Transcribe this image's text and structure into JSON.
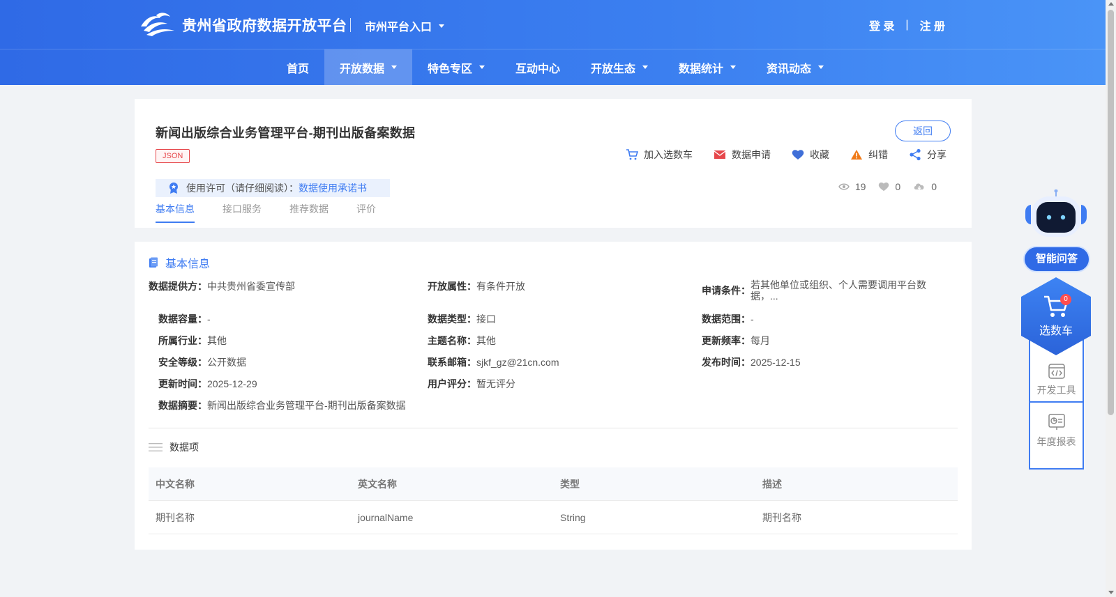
{
  "header": {
    "site_title": "贵州省政府数据开放平台",
    "city_entry": "市州平台入口",
    "login": "登 录",
    "auth_sep": "|",
    "register": "注 册"
  },
  "nav": {
    "items": [
      {
        "label": "首页",
        "has_dropdown": false,
        "active": false
      },
      {
        "label": "开放数据",
        "has_dropdown": true,
        "active": true
      },
      {
        "label": "特色专区",
        "has_dropdown": true,
        "active": false
      },
      {
        "label": "互动中心",
        "has_dropdown": false,
        "active": false
      },
      {
        "label": "开放生态",
        "has_dropdown": true,
        "active": false
      },
      {
        "label": "数据统计",
        "has_dropdown": true,
        "active": false
      },
      {
        "label": "资讯动态",
        "has_dropdown": true,
        "active": false
      }
    ]
  },
  "dataset": {
    "title": "新闻出版综合业务管理平台-期刊出版备案数据",
    "format_tag": "JSON",
    "back_label": "返回",
    "actions": {
      "add_cart": "加入选数车",
      "apply": "数据申请",
      "favorite": "收藏",
      "report_error": "纠错",
      "share": "分享"
    },
    "license_label": "使用许可（请仔细阅读）：",
    "license_link": "数据使用承诺书",
    "stats": {
      "views": "19",
      "likes": "0",
      "downloads": "0"
    },
    "tabs": [
      "基本信息",
      "接口服务",
      "推荐数据",
      "评价"
    ]
  },
  "basic_info": {
    "section_title": "基本信息",
    "fields": {
      "provider": {
        "label": "数据提供方：",
        "value": "中共贵州省委宣传部"
      },
      "open_attr": {
        "label": "开放属性：",
        "value": "有条件开放"
      },
      "apply_cond": {
        "label": "申请条件：",
        "value": "若其他单位或组织、个人需要调用平台数据，..."
      },
      "capacity": {
        "label": "数据容量：",
        "value": "-"
      },
      "data_type": {
        "label": "数据类型：",
        "value": "接口"
      },
      "data_range": {
        "label": "数据范围：",
        "value": "-"
      },
      "industry": {
        "label": "所属行业：",
        "value": "其他"
      },
      "topic": {
        "label": "主题名称：",
        "value": "其他"
      },
      "update_freq": {
        "label": "更新频率：",
        "value": "每月"
      },
      "security": {
        "label": "安全等级：",
        "value": "公开数据"
      },
      "email": {
        "label": "联系邮箱：",
        "value": "sjkf_gz@21cn.com"
      },
      "publish_time": {
        "label": "发布时间：",
        "value": "2025-12-15"
      },
      "update_time": {
        "label": "更新时间：",
        "value": "2025-12-29"
      },
      "rating": {
        "label": "用户评分：",
        "value": "暂无评分"
      },
      "summary": {
        "label": "数据摘要：",
        "value": "新闻出版综合业务管理平台-期刊出版备案数据"
      }
    }
  },
  "data_items": {
    "title": "数据项",
    "columns": [
      "中文名称",
      "英文名称",
      "类型",
      "描述"
    ],
    "rows": [
      [
        "期刊名称",
        "journalName",
        "String",
        "期刊名称"
      ]
    ]
  },
  "float_widgets": {
    "ai_qa": "智能问答",
    "cart_label": "选数车",
    "cart_count": "0",
    "dev_tools": "开发工具",
    "annual_report": "年度报表"
  },
  "colors": {
    "primary": "#3f7cf2",
    "header_start": "#2f6ae6",
    "header_end": "#4a94f7",
    "tag_red": "#e6474b"
  }
}
